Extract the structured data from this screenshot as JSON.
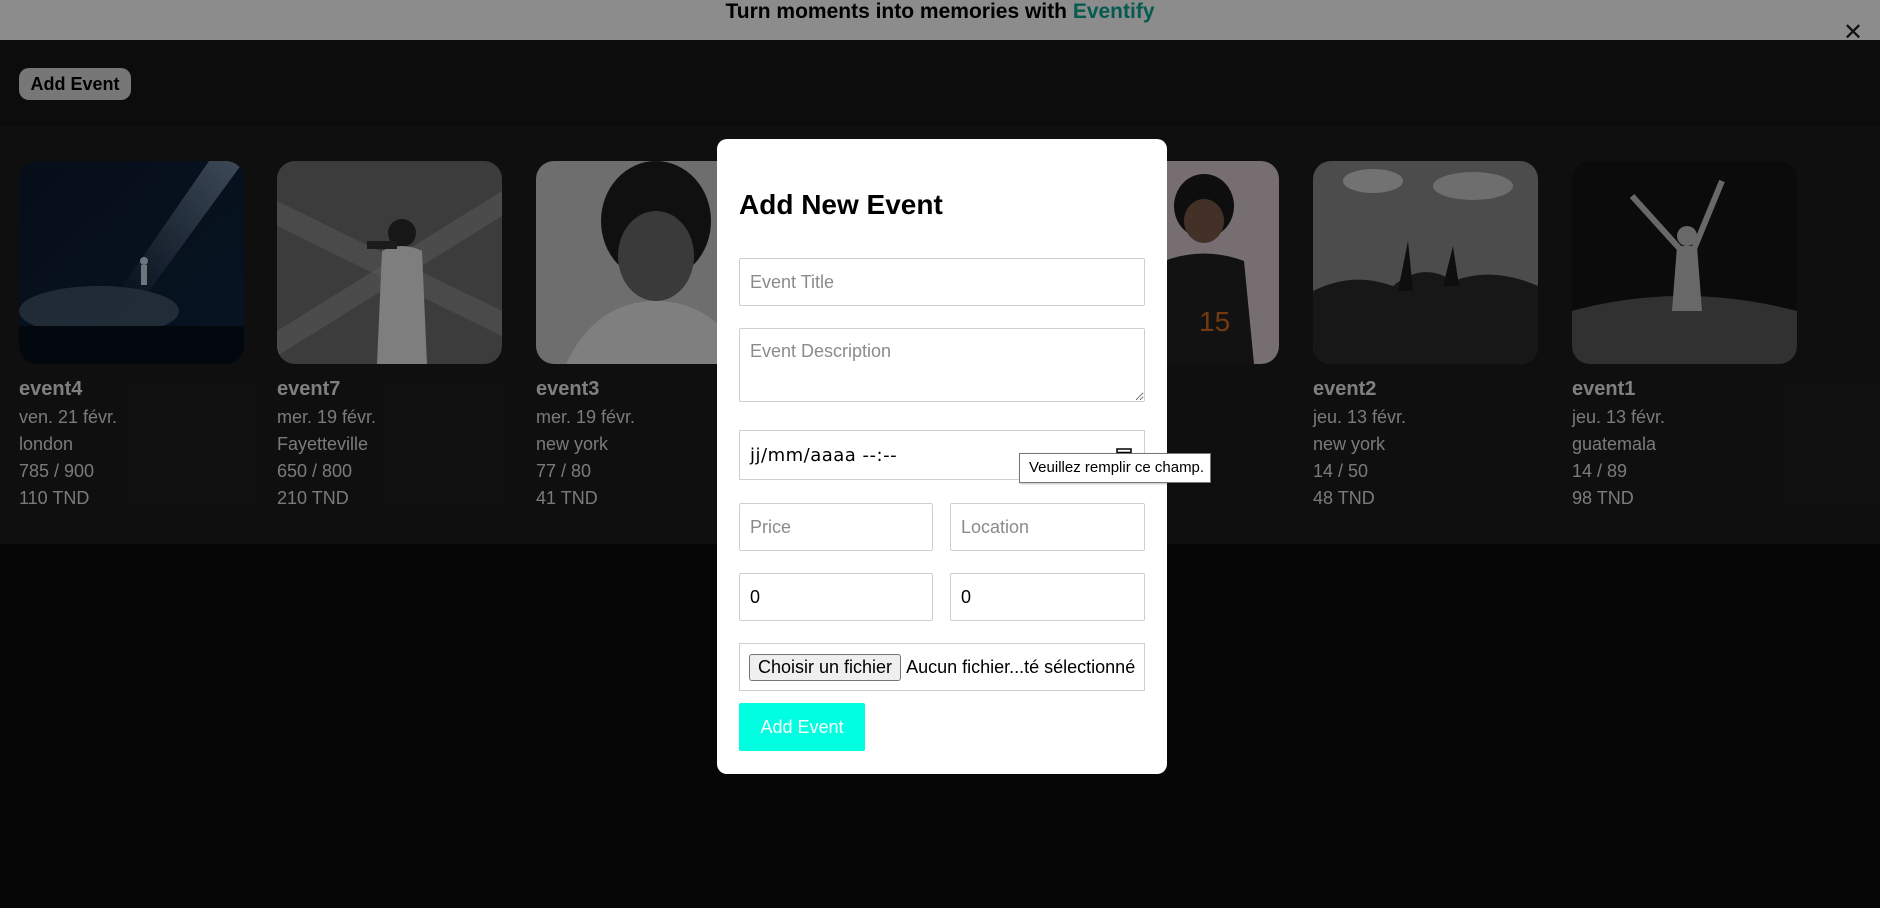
{
  "banner": {
    "text": "Turn moments into memories with",
    "brand": "Eventify"
  },
  "header": {
    "add_event_label": "Add Event",
    "close_label": "✕"
  },
  "events": [
    {
      "title": "event4",
      "date": "ven. 21 févr.",
      "location": "london",
      "capacity": "785 / 900",
      "price": "110 TND"
    },
    {
      "title": "event7",
      "date": "mer. 19 févr.",
      "location": "Fayetteville",
      "capacity": "650 / 800",
      "price": "210 TND"
    },
    {
      "title": "event3",
      "date": "mer. 19 févr.",
      "location": "new york",
      "capacity": "77 / 80",
      "price": "41 TND"
    },
    {
      "title": "",
      "date": "",
      "location": "",
      "capacity": "",
      "price": ""
    },
    {
      "title": "event2",
      "date": "jeu. 13 févr.",
      "location": "new york",
      "capacity": "14 / 50",
      "price": "48 TND"
    },
    {
      "title": "event1",
      "date": "jeu. 13 févr.",
      "location": "guatemala",
      "capacity": "14 / 89",
      "price": "98 TND"
    }
  ],
  "modal": {
    "title": "Add New Event",
    "title_placeholder": "Event Title",
    "description_placeholder": "Event Description",
    "datetime_text": "jj/mm/aaaa --:--",
    "price_placeholder": "Price",
    "location_placeholder": "Location",
    "capacity_value": "0",
    "booked_value": "0",
    "file_button_label": "Choisir un fichier",
    "file_status": "Aucun fichier...té sélectionné",
    "submit_label": "Add Event"
  },
  "tooltip": {
    "text": "Veuillez remplir ce champ."
  },
  "colors": {
    "brand": "#0aa693",
    "submit_button": "#00ffe1"
  }
}
